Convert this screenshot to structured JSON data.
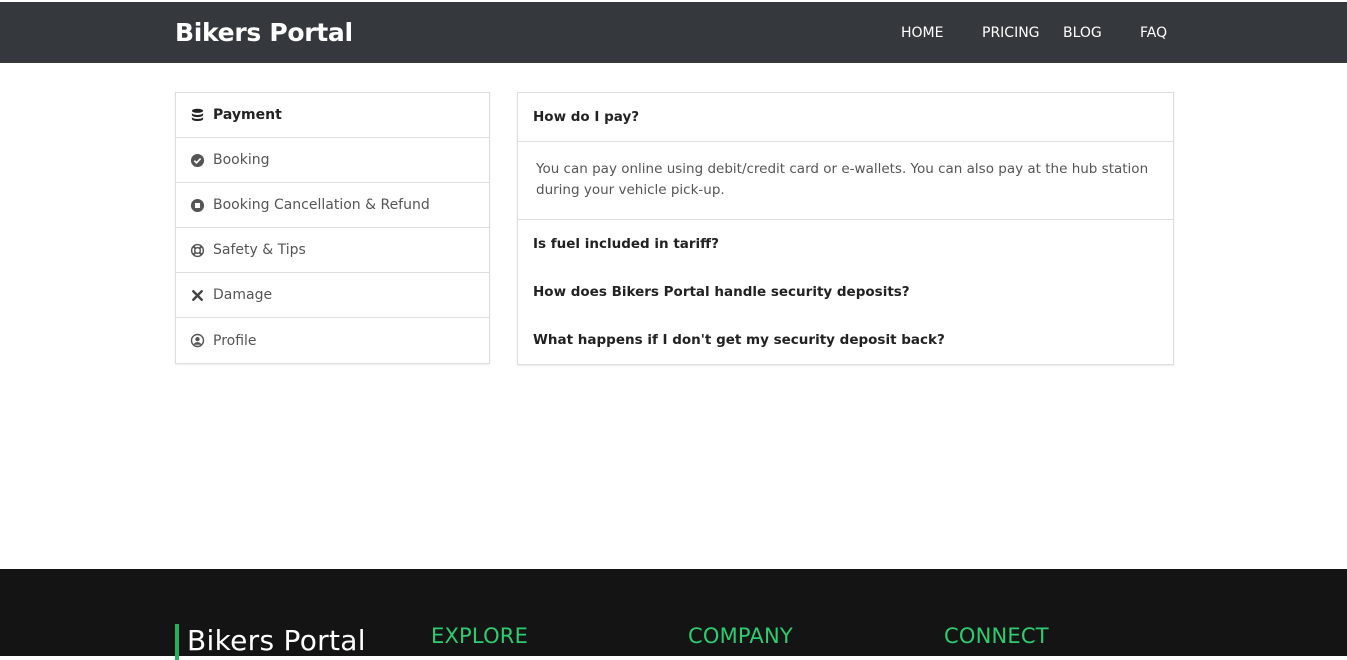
{
  "header": {
    "brand": "Bikers Portal",
    "nav": [
      "HOME",
      "PRICING",
      "BLOG",
      "FAQ"
    ]
  },
  "sidebar": {
    "items": [
      {
        "label": "Payment",
        "icon": "database-icon",
        "active": true
      },
      {
        "label": "Booking",
        "icon": "check-circle-icon",
        "active": false
      },
      {
        "label": "Booking Cancellation & Refund",
        "icon": "stop-circle-icon",
        "active": false
      },
      {
        "label": "Safety & Tips",
        "icon": "life-ring-icon",
        "active": false
      },
      {
        "label": "Damage",
        "icon": "times-icon",
        "active": false
      },
      {
        "label": "Profile",
        "icon": "user-circle-icon",
        "active": false
      }
    ]
  },
  "faq": {
    "open_question": "How do I pay?",
    "open_answer": "You can pay online using debit/credit card or e-wallets. You can also pay at the hub station during your vehicle pick-up.",
    "questions": [
      "Is fuel included in tariff?",
      "How does Bikers Portal handle security deposits?",
      "What happens if I don't get my security deposit back?"
    ]
  },
  "footer": {
    "brand": "Bikers Portal",
    "headings": [
      "EXPLORE",
      "COMPANY",
      "CONNECT"
    ]
  },
  "colors": {
    "navbar": "#35383c",
    "footer": "#141414",
    "accent": "#2ecc71"
  }
}
